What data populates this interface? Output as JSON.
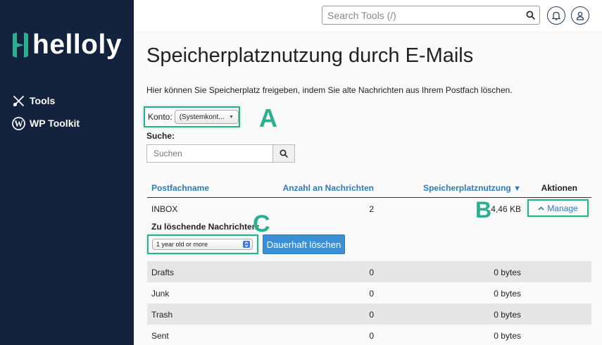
{
  "brand": {
    "name": "helloly",
    "accent": "#28b08f",
    "sidebar_bg": "#13233d"
  },
  "sidebar": {
    "items": [
      {
        "label": "Tools",
        "icon": "tools-icon"
      },
      {
        "label": "WP Toolkit",
        "icon": "wordpress-icon"
      }
    ]
  },
  "topbar": {
    "search_placeholder": "Search Tools (/)"
  },
  "page": {
    "title": "Speicherplatznutzung durch E-Mails",
    "description": "Hier können Sie Speicherplatz freigeben, indem Sie alte Nachrichten aus Ihrem Postfach löschen.",
    "konto_label": "Konto:",
    "konto_value": "(Systemkont...",
    "suche_label": "Suche:",
    "suche_placeholder": "Suchen"
  },
  "annotations": {
    "a": "A",
    "b": "B",
    "c": "C"
  },
  "table": {
    "headers": {
      "name": "Postfachname",
      "count": "Anzahl an Nachrichten",
      "usage": "Speicherplatznutzung",
      "actions": "Aktionen"
    },
    "inbox": {
      "name": "INBOX",
      "count": "2",
      "usage": "4,46 KB",
      "action": "Manage"
    },
    "expand": {
      "label": "Zu löschende Nachrichten:",
      "age_value": "1 year old or more",
      "delete_button": "Dauerhaft löschen"
    },
    "rows": [
      {
        "name": "Drafts",
        "count": "0",
        "usage": "0 bytes"
      },
      {
        "name": "Junk",
        "count": "0",
        "usage": "0 bytes"
      },
      {
        "name": "Trash",
        "count": "0",
        "usage": "0 bytes"
      },
      {
        "name": "Sent",
        "count": "0",
        "usage": "0 bytes"
      }
    ]
  }
}
